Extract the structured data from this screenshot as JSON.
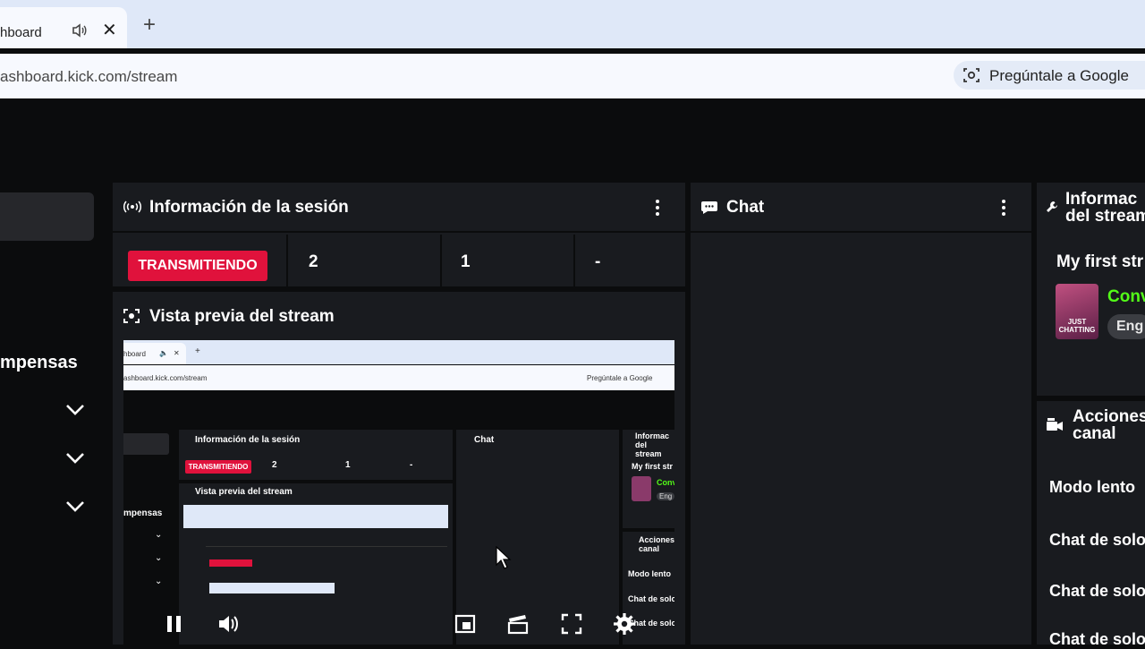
{
  "browser": {
    "tab_title": "hboard",
    "url": "ashboard.kick.com/stream",
    "ask_google": "Pregúntale a Google"
  },
  "sidebar": {
    "section_label": "mpensas"
  },
  "session_panel": {
    "title": "Información de la sesión",
    "status_badge": "TRANSMITIENDO",
    "stat_1": "2",
    "stat_2": "1",
    "stat_3": "-"
  },
  "preview_panel": {
    "title": "Vista previa del stream"
  },
  "chat_panel": {
    "title": "Chat"
  },
  "stream_info_panel": {
    "title_line1": "Informac",
    "title_line2": "del stream",
    "stream_title": "My first str",
    "category_text": "Conv",
    "language_chip": "Eng",
    "thumbnail_text": "JUST CHATTING"
  },
  "actions_panel": {
    "title_line1": "Acciones",
    "title_line2": "canal",
    "items": [
      "Modo lento",
      "Chat de solo",
      "Chat de solo",
      "Chat de solo"
    ]
  },
  "preview_content": {
    "tab_title": "hboard",
    "url": "ashboard.kick.com/stream",
    "ask_google": "Pregúntale a Google",
    "session_title": "Información de la sesión",
    "badge": "TRANSMITIENDO",
    "stat_1": "2",
    "stat_2": "1",
    "stat_3": "-",
    "chat_title": "Chat",
    "info_title": "Informac del stream",
    "stream_title": "My first str",
    "conv": "Conv",
    "eng": "Eng",
    "preview_title": "Vista previa del stream",
    "sidebar_label": "mpensas",
    "actions_title": "Acciones canal",
    "action_1": "Modo lento",
    "action_2": "Chat de solo",
    "action_3": "Chat de solo"
  },
  "colors": {
    "accent_green": "#53fc18",
    "live_red": "#e0123c",
    "panel_bg": "#191b1f",
    "page_bg": "#0b0c0d"
  }
}
